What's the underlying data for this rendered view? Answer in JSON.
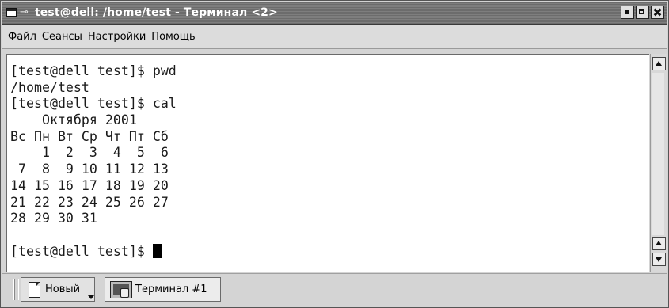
{
  "window": {
    "title": "test@dell: /home/test - Терминал <2>"
  },
  "menu": [
    {
      "label": "Файл"
    },
    {
      "label": "Сеансы"
    },
    {
      "label": "Настройки"
    },
    {
      "label": "Помощь"
    }
  ],
  "terminal": {
    "lines": [
      "[test@dell test]$ pwd",
      "/home/test",
      "[test@dell test]$ cal",
      "    Октября 2001",
      "Вс Пн Вт Ср Чт Пт Сб",
      "    1  2  3  4  5  6",
      " 7  8  9 10 11 12 13",
      "14 15 16 17 18 19 20",
      "21 22 23 24 25 26 27",
      "28 29 30 31",
      "",
      "[test@dell test]$ "
    ]
  },
  "tabs": {
    "new_label": "Новый",
    "session_label": "Терминал #1"
  },
  "icons": {
    "window": "window-menu-icon",
    "pin": "pin-icon",
    "minimize": "minimize-icon",
    "maximize": "maximize-icon",
    "close": "close-icon",
    "new_session": "new-session-icon",
    "terminal": "terminal-icon"
  }
}
